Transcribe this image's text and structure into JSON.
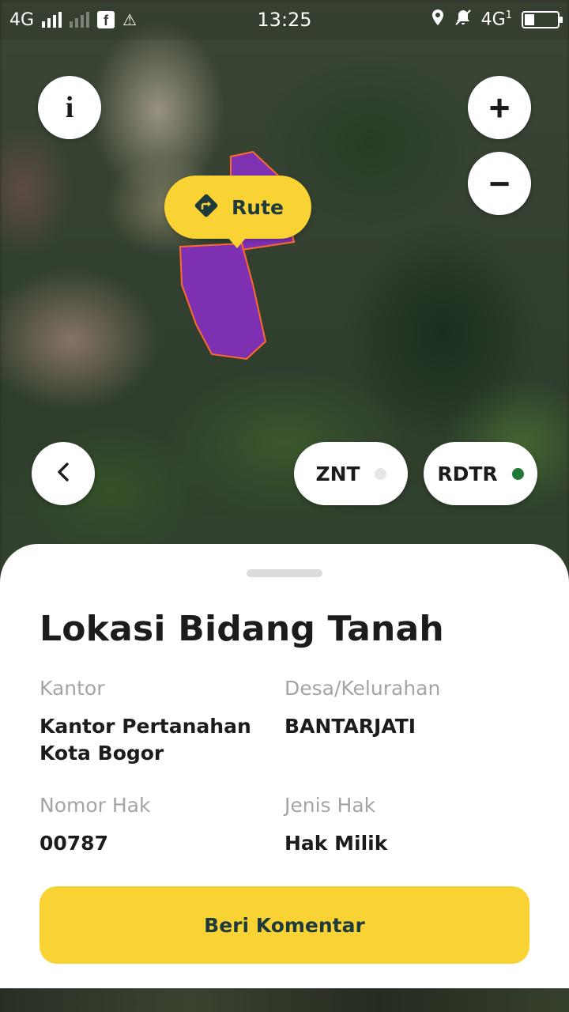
{
  "status_bar": {
    "network_left": "4G",
    "time": "13:25",
    "network_right": "4G",
    "network_right_sub": "1"
  },
  "map": {
    "route_button_label": "Rute",
    "layer_chips": [
      {
        "label": "ZNT",
        "status_color": "#e6e6e6"
      },
      {
        "label": "RDTR",
        "status_color": "#1f7a3a"
      }
    ],
    "parcel_fill": "#8b2fc9",
    "parcel_stroke": "#ff6a2a"
  },
  "colors": {
    "accent": "#f9d333",
    "accent_text": "#1f3a3c"
  },
  "sheet": {
    "title": "Lokasi Bidang Tanah",
    "fields": {
      "kantor_label": "Kantor",
      "kantor_value": "Kantor Pertanahan Kota Bogor",
      "desa_label": "Desa/Kelurahan",
      "desa_value": "BANTARJATI",
      "nomor_label": "Nomor Hak",
      "nomor_value": "00787",
      "jenis_label": "Jenis Hak",
      "jenis_value": "Hak Milik"
    },
    "comment_button": "Beri Komentar"
  }
}
